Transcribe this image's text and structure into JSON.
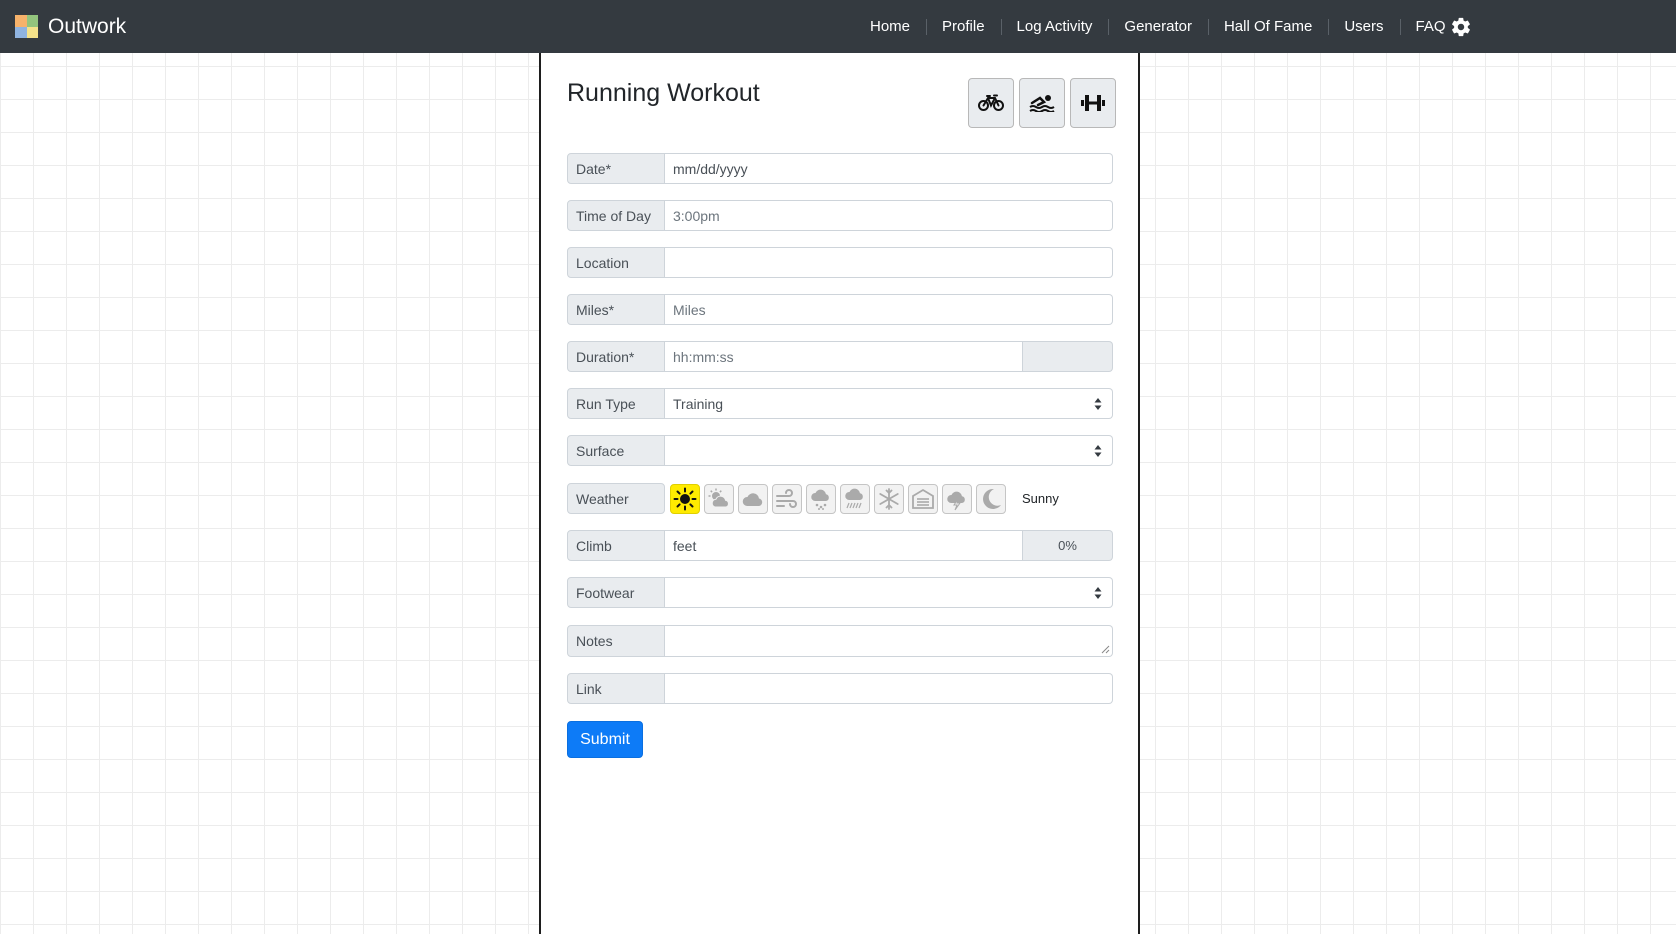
{
  "app": {
    "brand": "Outwork"
  },
  "nav": {
    "items": [
      "Home",
      "Profile",
      "Log Activity",
      "Generator",
      "Hall Of Fame",
      "Users",
      "FAQ"
    ]
  },
  "form": {
    "title": "Running Workout",
    "activity_buttons": [
      "bike-icon",
      "swim-icon",
      "weights-icon"
    ],
    "date": {
      "label": "Date*",
      "placeholder": "mm/dd/yyyy"
    },
    "time_of_day": {
      "label": "Time of Day",
      "placeholder": "3:00pm"
    },
    "location": {
      "label": "Location",
      "value": ""
    },
    "miles": {
      "label": "Miles*",
      "placeholder": "Miles"
    },
    "duration": {
      "label": "Duration*",
      "placeholder": "hh:mm:ss",
      "addon": ""
    },
    "run_type": {
      "label": "Run Type",
      "value": "Training"
    },
    "surface": {
      "label": "Surface",
      "value": ""
    },
    "weather": {
      "label": "Weather",
      "selected_label": "Sunny",
      "icons": [
        "sun-icon",
        "partly-cloudy-icon",
        "cloud-icon",
        "wind-icon",
        "rain-icon",
        "drizzle-icon",
        "snowflake-icon",
        "garage-icon",
        "hot-icon",
        "moon-icon"
      ],
      "selected_color": "#ffeb00"
    },
    "climb": {
      "label": "Climb",
      "placeholder": "feet",
      "addon": "0%"
    },
    "footwear": {
      "label": "Footwear",
      "value": ""
    },
    "notes": {
      "label": "Notes",
      "value": ""
    },
    "link": {
      "label": "Link",
      "value": ""
    },
    "submit_label": "Submit"
  },
  "colors": {
    "navbar": "#343a40",
    "primary": "#0d7bf7"
  }
}
